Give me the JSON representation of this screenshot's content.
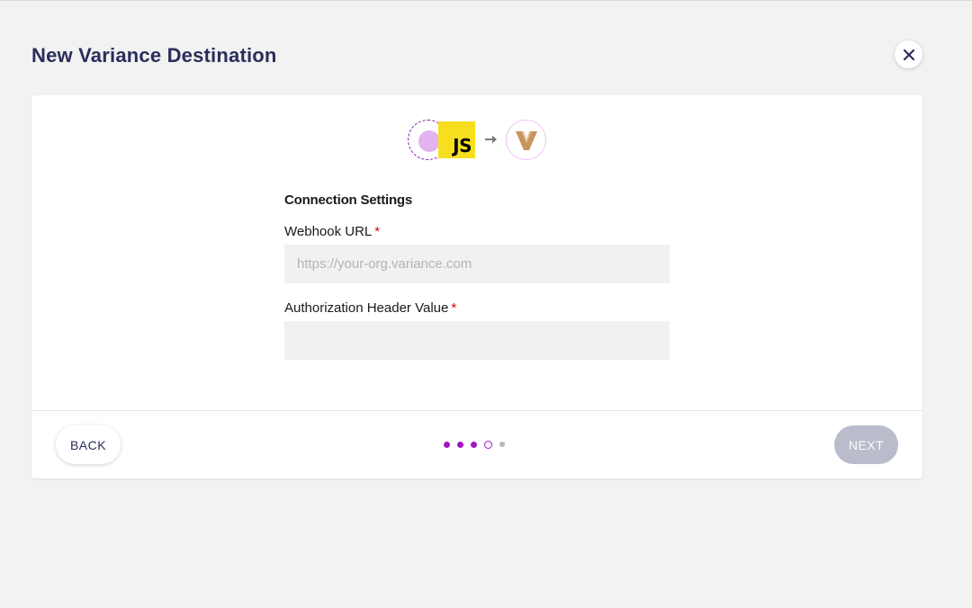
{
  "page": {
    "title": "New Variance Destination",
    "close_icon": "close-icon"
  },
  "flow": {
    "source_logo_text": "JS",
    "arrow_icon": "arrow-right-icon",
    "destination_icon": "variance-logo-icon"
  },
  "form": {
    "section_title": "Connection Settings",
    "webhook": {
      "label": "Webhook URL",
      "required_marker": "*",
      "value": "",
      "placeholder": "https://your-org.variance.com"
    },
    "auth": {
      "label": "Authorization Header Value",
      "required_marker": "*",
      "value": "",
      "placeholder": ""
    }
  },
  "footer": {
    "back_label": "BACK",
    "next_label": "NEXT",
    "steps": [
      "complete",
      "complete",
      "complete",
      "current",
      "upcoming"
    ]
  },
  "colors": {
    "accent": "#a018c2",
    "title": "#2a2e5a",
    "js_yellow": "#f7df1e",
    "variance_brand": "#c8955e",
    "required": "#d9000d",
    "disabled_button": "#b9bccb"
  }
}
